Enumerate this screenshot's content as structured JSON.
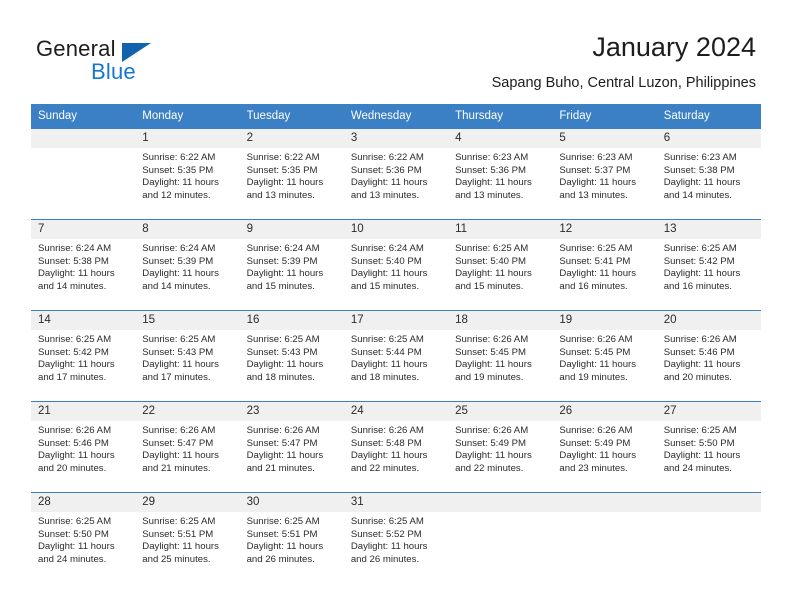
{
  "brand": {
    "name_top": "General",
    "name_bottom": "Blue",
    "triangle_color": "#1263ae",
    "blue_color": "#1578cf"
  },
  "header": {
    "title": "January 2024",
    "subtitle": "Sapang Buho, Central Luzon, Philippines"
  },
  "theme": {
    "header_row_bg": "#3b7fc4",
    "row_divider": "#3b7fc4",
    "daynum_bg": "#f0f0f0",
    "text": "#2b2b2b"
  },
  "calendar": {
    "weekday_headers": [
      "Sunday",
      "Monday",
      "Tuesday",
      "Wednesday",
      "Thursday",
      "Friday",
      "Saturday"
    ],
    "labels": {
      "sunrise": "Sunrise:",
      "sunset": "Sunset:",
      "daylight": "Daylight:"
    },
    "weeks": [
      [
        {
          "day": "",
          "sunrise": "",
          "sunset": "",
          "daylight_1": "",
          "daylight_2": ""
        },
        {
          "day": "1",
          "sunrise": "Sunrise: 6:22 AM",
          "sunset": "Sunset: 5:35 PM",
          "daylight_1": "Daylight: 11 hours",
          "daylight_2": "and 12 minutes."
        },
        {
          "day": "2",
          "sunrise": "Sunrise: 6:22 AM",
          "sunset": "Sunset: 5:35 PM",
          "daylight_1": "Daylight: 11 hours",
          "daylight_2": "and 13 minutes."
        },
        {
          "day": "3",
          "sunrise": "Sunrise: 6:22 AM",
          "sunset": "Sunset: 5:36 PM",
          "daylight_1": "Daylight: 11 hours",
          "daylight_2": "and 13 minutes."
        },
        {
          "day": "4",
          "sunrise": "Sunrise: 6:23 AM",
          "sunset": "Sunset: 5:36 PM",
          "daylight_1": "Daylight: 11 hours",
          "daylight_2": "and 13 minutes."
        },
        {
          "day": "5",
          "sunrise": "Sunrise: 6:23 AM",
          "sunset": "Sunset: 5:37 PM",
          "daylight_1": "Daylight: 11 hours",
          "daylight_2": "and 13 minutes."
        },
        {
          "day": "6",
          "sunrise": "Sunrise: 6:23 AM",
          "sunset": "Sunset: 5:38 PM",
          "daylight_1": "Daylight: 11 hours",
          "daylight_2": "and 14 minutes."
        }
      ],
      [
        {
          "day": "7",
          "sunrise": "Sunrise: 6:24 AM",
          "sunset": "Sunset: 5:38 PM",
          "daylight_1": "Daylight: 11 hours",
          "daylight_2": "and 14 minutes."
        },
        {
          "day": "8",
          "sunrise": "Sunrise: 6:24 AM",
          "sunset": "Sunset: 5:39 PM",
          "daylight_1": "Daylight: 11 hours",
          "daylight_2": "and 14 minutes."
        },
        {
          "day": "9",
          "sunrise": "Sunrise: 6:24 AM",
          "sunset": "Sunset: 5:39 PM",
          "daylight_1": "Daylight: 11 hours",
          "daylight_2": "and 15 minutes."
        },
        {
          "day": "10",
          "sunrise": "Sunrise: 6:24 AM",
          "sunset": "Sunset: 5:40 PM",
          "daylight_1": "Daylight: 11 hours",
          "daylight_2": "and 15 minutes."
        },
        {
          "day": "11",
          "sunrise": "Sunrise: 6:25 AM",
          "sunset": "Sunset: 5:40 PM",
          "daylight_1": "Daylight: 11 hours",
          "daylight_2": "and 15 minutes."
        },
        {
          "day": "12",
          "sunrise": "Sunrise: 6:25 AM",
          "sunset": "Sunset: 5:41 PM",
          "daylight_1": "Daylight: 11 hours",
          "daylight_2": "and 16 minutes."
        },
        {
          "day": "13",
          "sunrise": "Sunrise: 6:25 AM",
          "sunset": "Sunset: 5:42 PM",
          "daylight_1": "Daylight: 11 hours",
          "daylight_2": "and 16 minutes."
        }
      ],
      [
        {
          "day": "14",
          "sunrise": "Sunrise: 6:25 AM",
          "sunset": "Sunset: 5:42 PM",
          "daylight_1": "Daylight: 11 hours",
          "daylight_2": "and 17 minutes."
        },
        {
          "day": "15",
          "sunrise": "Sunrise: 6:25 AM",
          "sunset": "Sunset: 5:43 PM",
          "daylight_1": "Daylight: 11 hours",
          "daylight_2": "and 17 minutes."
        },
        {
          "day": "16",
          "sunrise": "Sunrise: 6:25 AM",
          "sunset": "Sunset: 5:43 PM",
          "daylight_1": "Daylight: 11 hours",
          "daylight_2": "and 18 minutes."
        },
        {
          "day": "17",
          "sunrise": "Sunrise: 6:25 AM",
          "sunset": "Sunset: 5:44 PM",
          "daylight_1": "Daylight: 11 hours",
          "daylight_2": "and 18 minutes."
        },
        {
          "day": "18",
          "sunrise": "Sunrise: 6:26 AM",
          "sunset": "Sunset: 5:45 PM",
          "daylight_1": "Daylight: 11 hours",
          "daylight_2": "and 19 minutes."
        },
        {
          "day": "19",
          "sunrise": "Sunrise: 6:26 AM",
          "sunset": "Sunset: 5:45 PM",
          "daylight_1": "Daylight: 11 hours",
          "daylight_2": "and 19 minutes."
        },
        {
          "day": "20",
          "sunrise": "Sunrise: 6:26 AM",
          "sunset": "Sunset: 5:46 PM",
          "daylight_1": "Daylight: 11 hours",
          "daylight_2": "and 20 minutes."
        }
      ],
      [
        {
          "day": "21",
          "sunrise": "Sunrise: 6:26 AM",
          "sunset": "Sunset: 5:46 PM",
          "daylight_1": "Daylight: 11 hours",
          "daylight_2": "and 20 minutes."
        },
        {
          "day": "22",
          "sunrise": "Sunrise: 6:26 AM",
          "sunset": "Sunset: 5:47 PM",
          "daylight_1": "Daylight: 11 hours",
          "daylight_2": "and 21 minutes."
        },
        {
          "day": "23",
          "sunrise": "Sunrise: 6:26 AM",
          "sunset": "Sunset: 5:47 PM",
          "daylight_1": "Daylight: 11 hours",
          "daylight_2": "and 21 minutes."
        },
        {
          "day": "24",
          "sunrise": "Sunrise: 6:26 AM",
          "sunset": "Sunset: 5:48 PM",
          "daylight_1": "Daylight: 11 hours",
          "daylight_2": "and 22 minutes."
        },
        {
          "day": "25",
          "sunrise": "Sunrise: 6:26 AM",
          "sunset": "Sunset: 5:49 PM",
          "daylight_1": "Daylight: 11 hours",
          "daylight_2": "and 22 minutes."
        },
        {
          "day": "26",
          "sunrise": "Sunrise: 6:26 AM",
          "sunset": "Sunset: 5:49 PM",
          "daylight_1": "Daylight: 11 hours",
          "daylight_2": "and 23 minutes."
        },
        {
          "day": "27",
          "sunrise": "Sunrise: 6:25 AM",
          "sunset": "Sunset: 5:50 PM",
          "daylight_1": "Daylight: 11 hours",
          "daylight_2": "and 24 minutes."
        }
      ],
      [
        {
          "day": "28",
          "sunrise": "Sunrise: 6:25 AM",
          "sunset": "Sunset: 5:50 PM",
          "daylight_1": "Daylight: 11 hours",
          "daylight_2": "and 24 minutes."
        },
        {
          "day": "29",
          "sunrise": "Sunrise: 6:25 AM",
          "sunset": "Sunset: 5:51 PM",
          "daylight_1": "Daylight: 11 hours",
          "daylight_2": "and 25 minutes."
        },
        {
          "day": "30",
          "sunrise": "Sunrise: 6:25 AM",
          "sunset": "Sunset: 5:51 PM",
          "daylight_1": "Daylight: 11 hours",
          "daylight_2": "and 26 minutes."
        },
        {
          "day": "31",
          "sunrise": "Sunrise: 6:25 AM",
          "sunset": "Sunset: 5:52 PM",
          "daylight_1": "Daylight: 11 hours",
          "daylight_2": "and 26 minutes."
        },
        {
          "day": "",
          "sunrise": "",
          "sunset": "",
          "daylight_1": "",
          "daylight_2": ""
        },
        {
          "day": "",
          "sunrise": "",
          "sunset": "",
          "daylight_1": "",
          "daylight_2": ""
        },
        {
          "day": "",
          "sunrise": "",
          "sunset": "",
          "daylight_1": "",
          "daylight_2": ""
        }
      ]
    ]
  }
}
